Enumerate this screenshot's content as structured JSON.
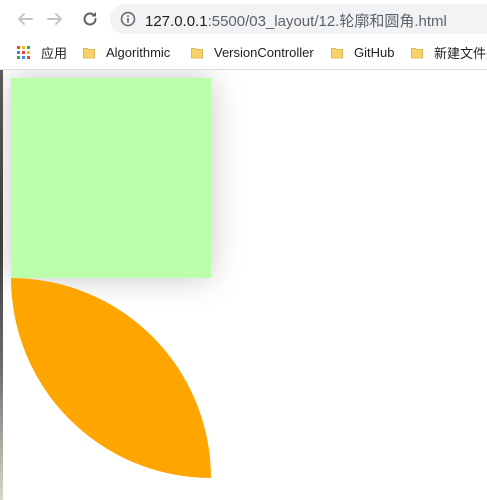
{
  "browser": {
    "url": {
      "host": "127.0.0.1",
      "path": ":5500/03_layout/12.轮廓和圆角.html"
    },
    "icons": {
      "back": "arrow-left-icon",
      "forward": "arrow-right-icon",
      "reload": "reload-icon",
      "info": "info-icon"
    }
  },
  "bookmarks": {
    "apps_label": "应用",
    "items": [
      {
        "label": "Algorithmic"
      },
      {
        "label": "VersionController"
      },
      {
        "label": "GitHub"
      },
      {
        "label": "新建文件夹"
      }
    ]
  },
  "colors": {
    "box": "#bbffaa",
    "leaf": "#ffa500",
    "folder": "#f6d36b"
  }
}
